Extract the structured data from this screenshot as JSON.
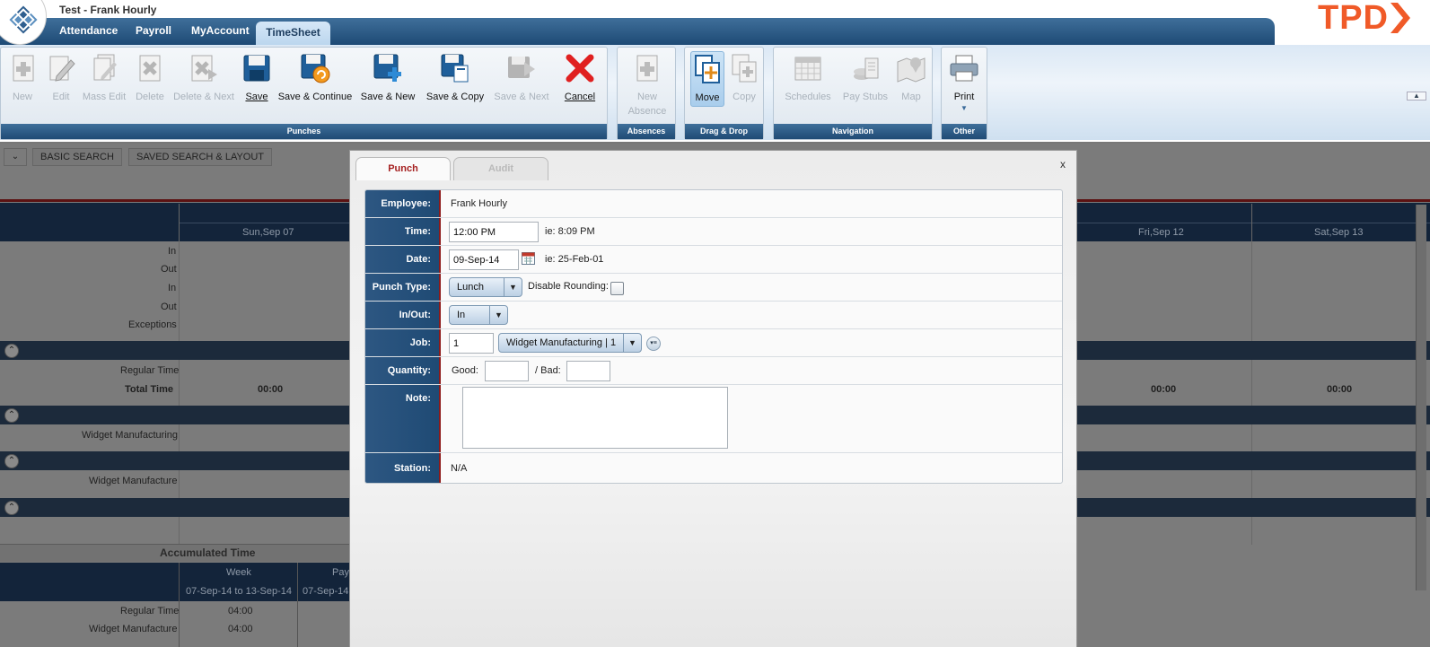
{
  "header": {
    "window_title": "Test - Frank Hourly",
    "nav": [
      "Attendance",
      "Payroll",
      "MyAccount",
      "TimeSheet"
    ],
    "brand": "TPD",
    "brand_color": "#f05a28"
  },
  "ribbon": {
    "punches": {
      "label": "Punches",
      "new": "New",
      "edit": "Edit",
      "mass_edit": "Mass Edit",
      "delete": "Delete",
      "delete_next": "Delete & Next",
      "save": "Save",
      "save_continue": "Save & Continue",
      "save_new": "Save & New",
      "save_copy": "Save & Copy",
      "save_next": "Save & Next",
      "cancel": "Cancel"
    },
    "absences": {
      "label": "Absences",
      "new_absence_1": "New",
      "new_absence_2": "Absence"
    },
    "dragdrop": {
      "label": "Drag & Drop",
      "move": "Move",
      "copy": "Copy"
    },
    "navigation": {
      "label": "Navigation",
      "schedules": "Schedules",
      "pay_stubs": "Pay Stubs",
      "map": "Map"
    },
    "other": {
      "label": "Other",
      "print": "Print"
    }
  },
  "background": {
    "tabs": [
      "BASIC SEARCH",
      "SAVED SEARCH & LAYOUT"
    ],
    "days": [
      "Sun,Sep 07",
      "Fri,Sep 12",
      "Sat,Sep 13"
    ],
    "row_labels": [
      "In",
      "Out",
      "In",
      "Out",
      "Exceptions"
    ],
    "regular_time": "Regular Time",
    "total_time": "Total Time",
    "total_values": [
      "00:00",
      "00:00",
      "00:00"
    ],
    "widget_manufacturing": "Widget Manufacturing",
    "widget_manufacture": "Widget Manufacture",
    "accumulated": {
      "title": "Accumulated Time",
      "week": "Week",
      "pay": "Pay",
      "range": "07-Sep-14 to 13-Sep-14",
      "range2": "07-Sep-14",
      "regular_time": "Regular Time",
      "regular_value": "04:00",
      "widget": "Widget Manufacture",
      "widget_value": "04:00"
    }
  },
  "dialog": {
    "tabs": {
      "punch": "Punch",
      "audit": "Audit"
    },
    "close": "x",
    "fields": {
      "employee_label": "Employee:",
      "employee_value": "Frank Hourly",
      "time_label": "Time:",
      "time_value": "12:00 PM",
      "time_hint": "ie: 8:09 PM",
      "date_label": "Date:",
      "date_value": "09-Sep-14",
      "date_hint": "ie: 25-Feb-01",
      "punch_type_label": "Punch Type:",
      "punch_type_value": "Lunch",
      "disable_rounding": "Disable Rounding:",
      "inout_label": "In/Out:",
      "inout_value": "In",
      "job_label": "Job:",
      "job_code": "1",
      "job_value": "Widget Manufacturing | 1",
      "quantity_label": "Quantity:",
      "good_label": "Good:",
      "bad_label": "/ Bad:",
      "note_label": "Note:",
      "station_label": "Station:",
      "station_value": "N/A"
    }
  }
}
